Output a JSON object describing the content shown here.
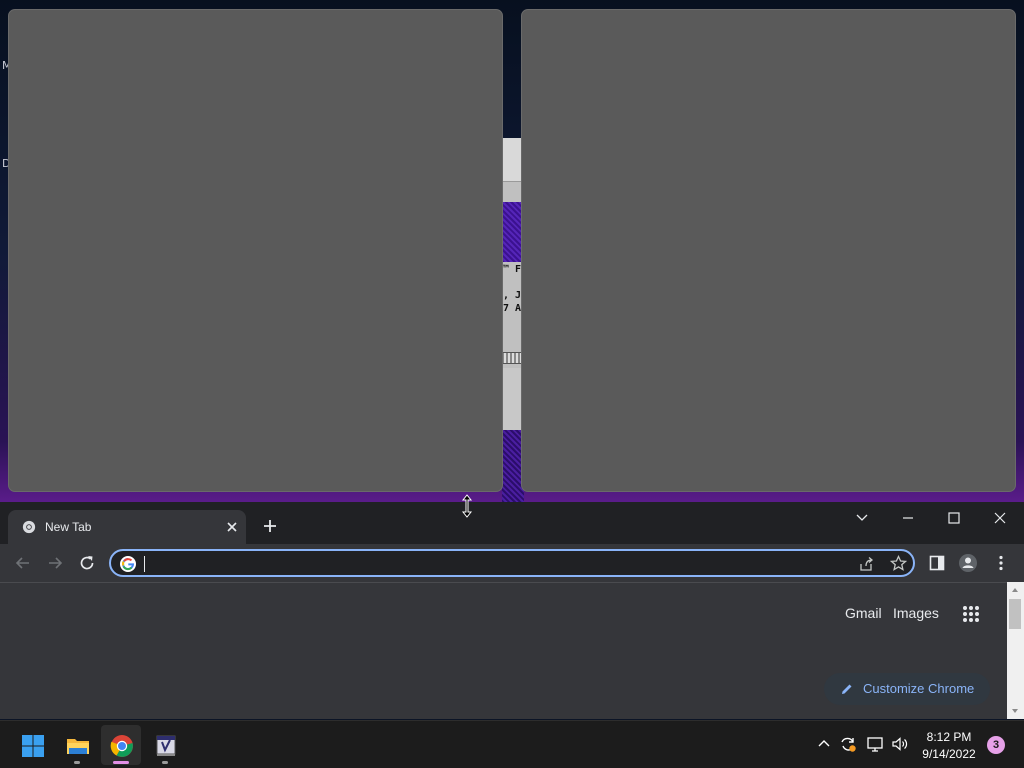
{
  "desktop": {
    "edge_letters": [
      "M",
      "D"
    ],
    "retro_app_fragments": [
      "™ F",
      ", J",
      "7 A"
    ]
  },
  "browser": {
    "tab": {
      "title": "New Tab"
    },
    "omnibox": {
      "value": "",
      "placeholder": ""
    },
    "newtab_links": {
      "gmail": "Gmail",
      "images": "Images"
    },
    "customize_label": "Customize Chrome",
    "accent_color": "#8ab4f8",
    "theme": "dark"
  },
  "taskbar": {
    "apps": [
      {
        "name": "Start",
        "icon": "windows-start-icon"
      },
      {
        "name": "File Explorer",
        "icon": "folder-icon"
      },
      {
        "name": "Google Chrome",
        "icon": "chrome-icon",
        "active": true
      },
      {
        "name": "Terminal App",
        "icon": "app-window-icon"
      }
    ],
    "clock": {
      "time": "8:12 PM",
      "date": "9/14/2022"
    },
    "notification_count": "3"
  }
}
